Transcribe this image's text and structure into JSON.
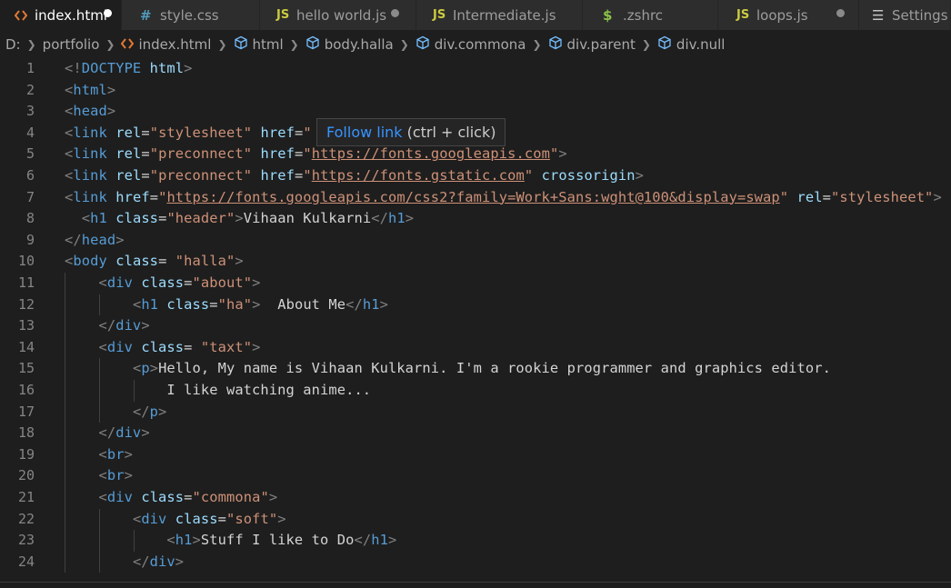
{
  "tabs": [
    {
      "label": "index.html",
      "icon": "html-icon",
      "active": true,
      "modified": true
    },
    {
      "label": "style.css",
      "icon": "hash-icon",
      "active": false,
      "modified": false
    },
    {
      "label": "hello world.js",
      "icon": "js-icon",
      "active": false,
      "modified": true
    },
    {
      "label": "Intermediate.js",
      "icon": "js-icon",
      "active": false,
      "modified": false
    },
    {
      "label": ".zshrc",
      "icon": "dollar-icon",
      "active": false,
      "modified": false
    },
    {
      "label": "loops.js",
      "icon": "js-icon",
      "active": false,
      "modified": true
    },
    {
      "label": "Settings",
      "icon": "settings-list-icon",
      "active": false,
      "modified": false
    }
  ],
  "icons": {
    "js": "JS",
    "hash": "#",
    "dollar": "$",
    "settings": "☰"
  },
  "breadcrumb": [
    "D:",
    "portfolio",
    "index.html",
    "html",
    "body.halla",
    "div.commona",
    "div.parent",
    "div.null"
  ],
  "tooltip": {
    "link": "Follow link",
    "hint": "(ctrl + click)"
  },
  "colors": {
    "background": "#1e1e1e",
    "tag": "#569cd6",
    "attribute": "#9cdcfe",
    "string": "#ce9178",
    "text": "#d4d4d4",
    "line_number": "#858585",
    "link": "#3794ff"
  },
  "lines": [
    {
      "n": "1",
      "indent": 0,
      "tokens": [
        [
          "punc",
          "<!"
        ],
        [
          "tag",
          "DOCTYPE"
        ],
        [
          "text",
          " "
        ],
        [
          "attr",
          "html"
        ],
        [
          "punc",
          ">"
        ]
      ]
    },
    {
      "n": "2",
      "indent": 0,
      "tokens": [
        [
          "punc",
          "<"
        ],
        [
          "tag",
          "html"
        ],
        [
          "punc",
          ">"
        ]
      ]
    },
    {
      "n": "3",
      "indent": 0,
      "tokens": [
        [
          "punc",
          "<"
        ],
        [
          "tag",
          "head"
        ],
        [
          "punc",
          ">"
        ]
      ]
    },
    {
      "n": "4",
      "indent": 0,
      "tokens": [
        [
          "punc",
          "<"
        ],
        [
          "tag",
          "link"
        ],
        [
          "text",
          " "
        ],
        [
          "attr",
          "rel"
        ],
        [
          "text",
          "="
        ],
        [
          "str",
          "\"stylesheet\""
        ],
        [
          "text",
          " "
        ],
        [
          "attr",
          "href"
        ],
        [
          "text",
          "="
        ],
        [
          "str",
          "\""
        ]
      ]
    },
    {
      "n": "5",
      "indent": 0,
      "tokens": [
        [
          "punc",
          "<"
        ],
        [
          "tag",
          "link"
        ],
        [
          "text",
          " "
        ],
        [
          "attr",
          "rel"
        ],
        [
          "text",
          "="
        ],
        [
          "str",
          "\"preconnect\""
        ],
        [
          "text",
          " "
        ],
        [
          "attr",
          "href"
        ],
        [
          "text",
          "="
        ],
        [
          "str",
          "\""
        ],
        [
          "link",
          "https://fonts.googleapis.com"
        ],
        [
          "str",
          "\""
        ],
        [
          "punc",
          ">"
        ]
      ]
    },
    {
      "n": "6",
      "indent": 0,
      "tokens": [
        [
          "punc",
          "<"
        ],
        [
          "tag",
          "link"
        ],
        [
          "text",
          " "
        ],
        [
          "attr",
          "rel"
        ],
        [
          "text",
          "="
        ],
        [
          "str",
          "\"preconnect\""
        ],
        [
          "text",
          " "
        ],
        [
          "attr",
          "href"
        ],
        [
          "text",
          "="
        ],
        [
          "str",
          "\""
        ],
        [
          "link",
          "https://fonts.gstatic.com"
        ],
        [
          "str",
          "\""
        ],
        [
          "text",
          " "
        ],
        [
          "attr",
          "crossorigin"
        ],
        [
          "punc",
          ">"
        ]
      ]
    },
    {
      "n": "7",
      "indent": 0,
      "tokens": [
        [
          "punc",
          "<"
        ],
        [
          "tag",
          "link"
        ],
        [
          "text",
          " "
        ],
        [
          "attr",
          "href"
        ],
        [
          "text",
          "="
        ],
        [
          "str",
          "\""
        ],
        [
          "link",
          "https://fonts.googleapis.com/css2?family=Work+Sans:wght@100&display=swap"
        ],
        [
          "str",
          "\""
        ],
        [
          "text",
          " "
        ],
        [
          "attr",
          "rel"
        ],
        [
          "text",
          "="
        ],
        [
          "str",
          "\"stylesheet\""
        ],
        [
          "punc",
          ">"
        ]
      ]
    },
    {
      "n": "8",
      "indent": 0,
      "tokens": [
        [
          "text",
          "  "
        ],
        [
          "punc",
          "<"
        ],
        [
          "tag",
          "h1"
        ],
        [
          "text",
          " "
        ],
        [
          "attr",
          "class"
        ],
        [
          "text",
          "="
        ],
        [
          "str",
          "\"header\""
        ],
        [
          "punc",
          ">"
        ],
        [
          "text",
          "Vihaan Kulkarni"
        ],
        [
          "punc",
          "</"
        ],
        [
          "tag",
          "h1"
        ],
        [
          "punc",
          ">"
        ]
      ]
    },
    {
      "n": "9",
      "indent": 0,
      "tokens": [
        [
          "punc",
          "</"
        ],
        [
          "tag",
          "head"
        ],
        [
          "punc",
          ">"
        ]
      ]
    },
    {
      "n": "10",
      "indent": 0,
      "tokens": [
        [
          "punc",
          "<"
        ],
        [
          "tag",
          "body"
        ],
        [
          "text",
          " "
        ],
        [
          "attr",
          "class"
        ],
        [
          "text",
          "= "
        ],
        [
          "str",
          "\"halla\""
        ],
        [
          "punc",
          ">"
        ]
      ]
    },
    {
      "n": "11",
      "indent": 1,
      "tokens": [
        [
          "text",
          "    "
        ],
        [
          "punc",
          "<"
        ],
        [
          "tag",
          "div"
        ],
        [
          "text",
          " "
        ],
        [
          "attr",
          "class"
        ],
        [
          "text",
          "="
        ],
        [
          "str",
          "\"about\""
        ],
        [
          "punc",
          ">"
        ]
      ]
    },
    {
      "n": "12",
      "indent": 2,
      "tokens": [
        [
          "text",
          "        "
        ],
        [
          "punc",
          "<"
        ],
        [
          "tag",
          "h1"
        ],
        [
          "text",
          " "
        ],
        [
          "attr",
          "class"
        ],
        [
          "text",
          "="
        ],
        [
          "str",
          "\"ha\""
        ],
        [
          "punc",
          ">"
        ],
        [
          "text",
          "  About Me"
        ],
        [
          "punc",
          "</"
        ],
        [
          "tag",
          "h1"
        ],
        [
          "punc",
          ">"
        ]
      ]
    },
    {
      "n": "13",
      "indent": 1,
      "tokens": [
        [
          "text",
          "    "
        ],
        [
          "punc",
          "</"
        ],
        [
          "tag",
          "div"
        ],
        [
          "punc",
          ">"
        ]
      ]
    },
    {
      "n": "14",
      "indent": 1,
      "tokens": [
        [
          "text",
          "    "
        ],
        [
          "punc",
          "<"
        ],
        [
          "tag",
          "div"
        ],
        [
          "text",
          " "
        ],
        [
          "attr",
          "class"
        ],
        [
          "text",
          "= "
        ],
        [
          "str",
          "\"taxt\""
        ],
        [
          "punc",
          ">"
        ]
      ]
    },
    {
      "n": "15",
      "indent": 2,
      "tokens": [
        [
          "text",
          "        "
        ],
        [
          "punc",
          "<"
        ],
        [
          "tag",
          "p"
        ],
        [
          "punc",
          ">"
        ],
        [
          "text",
          "Hello, My name is Vihaan Kulkarni. I'm a rookie programmer and graphics editor."
        ]
      ]
    },
    {
      "n": "16",
      "indent": 3,
      "tokens": [
        [
          "text",
          "            I like watching anime..."
        ]
      ]
    },
    {
      "n": "17",
      "indent": 2,
      "tokens": [
        [
          "text",
          "        "
        ],
        [
          "punc",
          "</"
        ],
        [
          "tag",
          "p"
        ],
        [
          "punc",
          ">"
        ]
      ]
    },
    {
      "n": "18",
      "indent": 1,
      "tokens": [
        [
          "text",
          "    "
        ],
        [
          "punc",
          "</"
        ],
        [
          "tag",
          "div"
        ],
        [
          "punc",
          ">"
        ]
      ]
    },
    {
      "n": "19",
      "indent": 1,
      "tokens": [
        [
          "text",
          "    "
        ],
        [
          "punc",
          "<"
        ],
        [
          "tag",
          "br"
        ],
        [
          "punc",
          ">"
        ]
      ]
    },
    {
      "n": "20",
      "indent": 1,
      "tokens": [
        [
          "text",
          "    "
        ],
        [
          "punc",
          "<"
        ],
        [
          "tag",
          "br"
        ],
        [
          "punc",
          ">"
        ]
      ]
    },
    {
      "n": "21",
      "indent": 1,
      "tokens": [
        [
          "text",
          "    "
        ],
        [
          "punc",
          "<"
        ],
        [
          "tag",
          "div"
        ],
        [
          "text",
          " "
        ],
        [
          "attr",
          "class"
        ],
        [
          "text",
          "="
        ],
        [
          "str",
          "\"commona\""
        ],
        [
          "punc",
          ">"
        ]
      ]
    },
    {
      "n": "22",
      "indent": 2,
      "tokens": [
        [
          "text",
          "        "
        ],
        [
          "punc",
          "<"
        ],
        [
          "tag",
          "div"
        ],
        [
          "text",
          " "
        ],
        [
          "attr",
          "class"
        ],
        [
          "text",
          "="
        ],
        [
          "str",
          "\"soft\""
        ],
        [
          "punc",
          ">"
        ]
      ]
    },
    {
      "n": "23",
      "indent": 3,
      "tokens": [
        [
          "text",
          "            "
        ],
        [
          "punc",
          "<"
        ],
        [
          "tag",
          "h1"
        ],
        [
          "punc",
          ">"
        ],
        [
          "text",
          "Stuff I like to Do"
        ],
        [
          "punc",
          "</"
        ],
        [
          "tag",
          "h1"
        ],
        [
          "punc",
          ">"
        ]
      ]
    },
    {
      "n": "24",
      "indent": 2,
      "tokens": [
        [
          "text",
          "        "
        ],
        [
          "punc",
          "</"
        ],
        [
          "tag",
          "div"
        ],
        [
          "punc",
          ">"
        ]
      ]
    }
  ]
}
